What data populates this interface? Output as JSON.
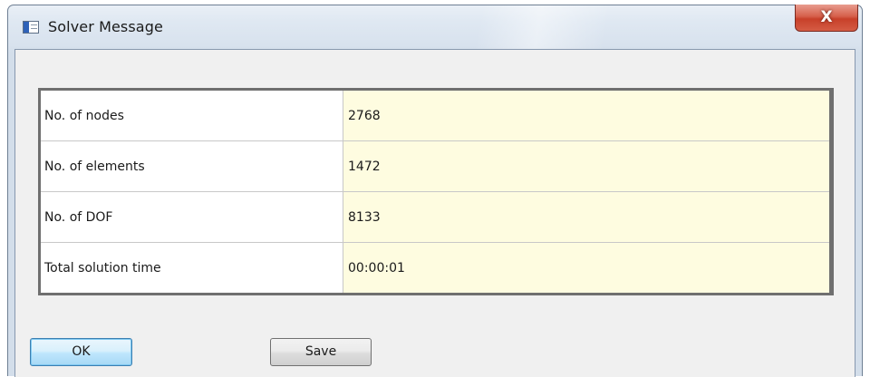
{
  "window": {
    "title": "Solver Message",
    "close_label": "X"
  },
  "results": {
    "rows": [
      {
        "label": "No. of nodes",
        "value": "2768"
      },
      {
        "label": "No. of elements",
        "value": "1472"
      },
      {
        "label": "No. of DOF",
        "value": "8133"
      },
      {
        "label": "Total solution time",
        "value": "00:00:01"
      }
    ]
  },
  "buttons": {
    "ok_label": "OK",
    "save_label": "Save"
  },
  "colors": {
    "value_background": "#fefce0",
    "close_button": "#c8402a",
    "default_button_border": "#3c7fb1"
  },
  "icons": {
    "app_icon": "window-app-icon",
    "close_icon": "close-icon"
  }
}
